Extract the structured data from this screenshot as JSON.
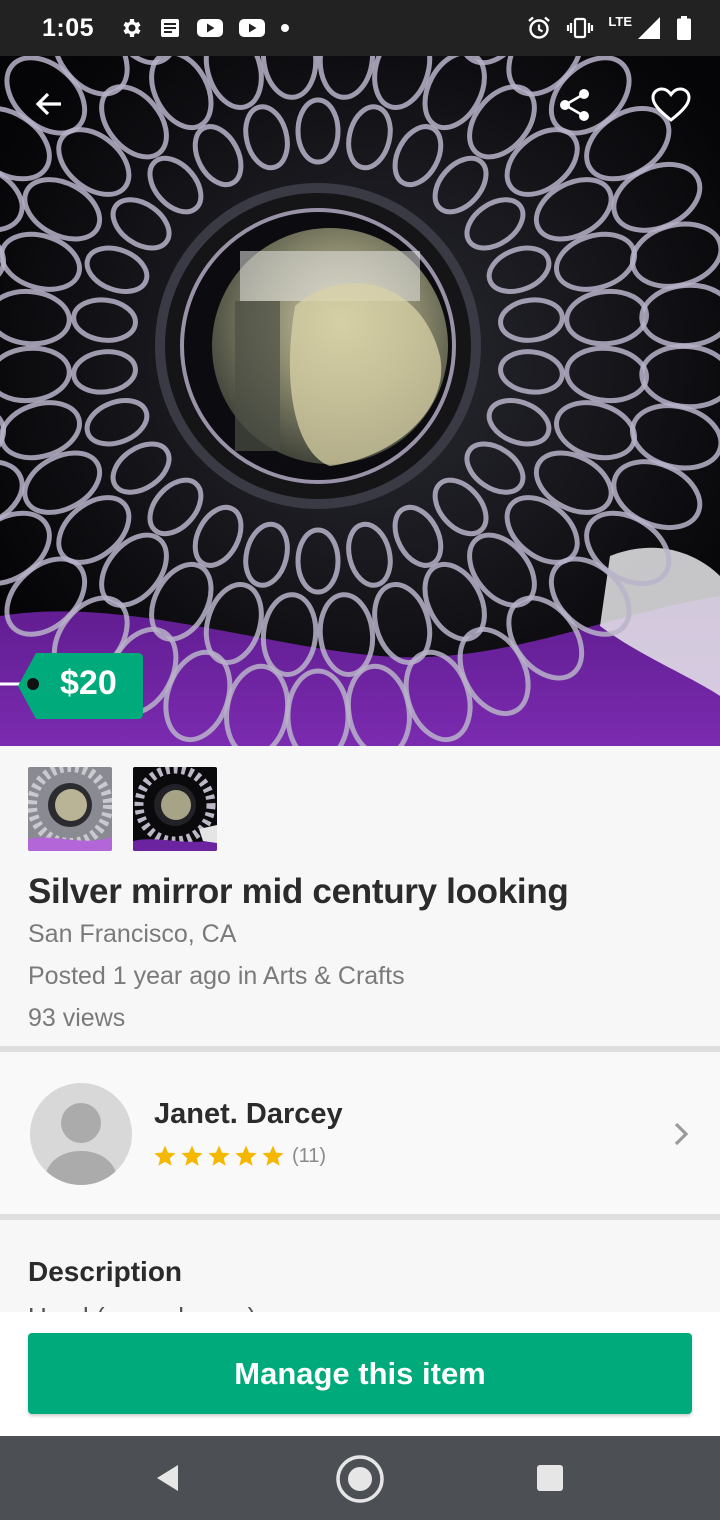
{
  "status_bar": {
    "time": "1:05",
    "network": "LTE",
    "icons": [
      "settings-icon",
      "news-icon",
      "youtube-icon",
      "youtube-icon",
      "dot-icon",
      "alarm-icon",
      "vibrate-icon",
      "signal-icon",
      "battery-icon"
    ]
  },
  "hero": {
    "icons": [
      "back-arrow-icon",
      "share-icon",
      "heart-icon"
    ],
    "price": "$20",
    "colors": {
      "price_tag": "#00aa7a"
    }
  },
  "thumbnails": {
    "count": 2
  },
  "item": {
    "title": "Silver mirror mid century looking",
    "location": "San Francisco, CA",
    "posted": "Posted 1 year ago in Arts & Crafts",
    "views": "93 views"
  },
  "seller": {
    "name": "Janet. Darcey",
    "rating": 5,
    "rating_max": 5,
    "review_count": "(11)",
    "colors": {
      "star": "#f5b800"
    }
  },
  "description": {
    "heading": "Description",
    "text_peek": "Used (normal wear)"
  },
  "action": {
    "label": "Manage this item",
    "color": "#00aa7a"
  },
  "nav_bar": {
    "icons": [
      "nav-back-icon",
      "nav-home-icon",
      "nav-recents-icon"
    ]
  }
}
